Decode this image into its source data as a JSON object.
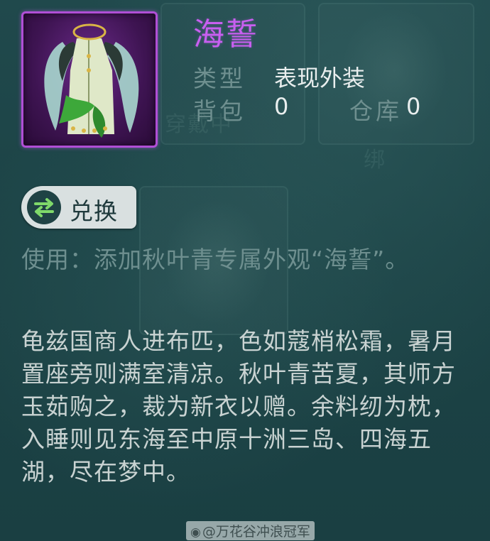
{
  "item": {
    "name": "海誓",
    "type_label": "类型",
    "type_value": "表现外装",
    "bag_label": "背包",
    "bag_count": "0",
    "warehouse_label": "仓库",
    "warehouse_count": "0",
    "icon": "robe-costume-icon"
  },
  "background": {
    "ghost_text_1": "穿戴中",
    "ghost_text_2": "绑"
  },
  "actions": {
    "exchange_label": "兑换",
    "exchange_icon": "swap-arrows-icon"
  },
  "usage": {
    "text": "使用：添加秋叶青专属外观“海誓”。"
  },
  "description": {
    "text": "龟兹国商人进布匹，色如蔻梢松霜，暑月置座旁则满室清凉。秋叶青苦夏，其师方玉茹购之，裁为新衣以赠。余料纫为枕，入睡则见东海至中原十洲三岛、四海五湖，尽在梦中。"
  },
  "watermark": {
    "text": "@万花谷冲浪冠军",
    "icon": "weibo-icon"
  },
  "colors": {
    "panel_bg": "#1d4548",
    "rarity_purple": "#b04fd6",
    "name_color": "#c85ff0",
    "label_color": "#6e8f8f",
    "text_color": "#c9d3d2",
    "exchange_green": "#7fd96a"
  }
}
